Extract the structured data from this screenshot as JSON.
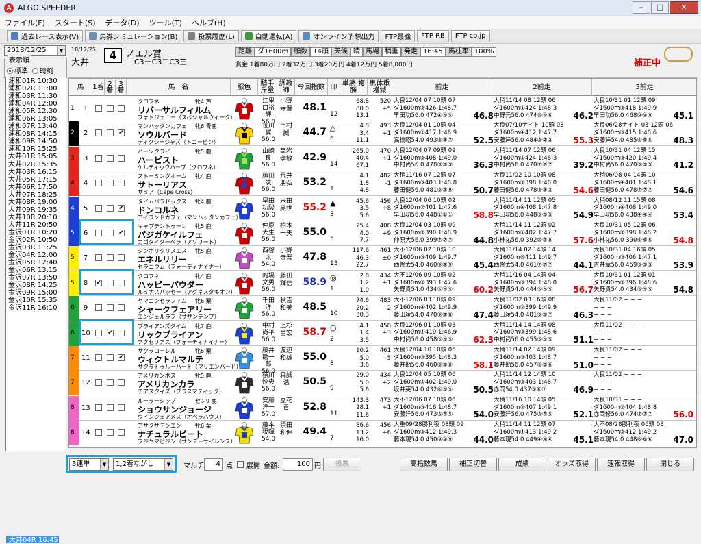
{
  "window": {
    "title": "ALGO SPEEDER",
    "controls": [
      "‒",
      "□",
      "✕"
    ]
  },
  "menu": [
    "ファイル(F)",
    "スタート(S)",
    "データ(D)",
    "ツール(T)",
    "ヘルプ(H)"
  ],
  "toolbar": [
    {
      "label": "過去レース表示(V)",
      "icon": "search-icon",
      "color": "#4a7fc1"
    },
    {
      "label": "馬券シミュレーション(B)",
      "icon": "ticket-icon",
      "color": "#6a8fb8"
    },
    {
      "label": "投票履歴(L)",
      "icon": "list-icon",
      "color": "#7f7f7f"
    },
    {
      "label": "自動運転(A)",
      "icon": "gear-icon",
      "color": "#3c9a3c"
    },
    {
      "label": "オンライン予想出力",
      "icon": "document-icon",
      "color": "#5b8cc0"
    },
    {
      "label": "FTP最強",
      "icon": "",
      "color": ""
    },
    {
      "label": "FTP RB",
      "icon": "",
      "color": ""
    },
    {
      "label": "FTP co.jp",
      "icon": "",
      "color": ""
    }
  ],
  "date": "2018/12/25",
  "order": {
    "legend": "表示順",
    "opt1": "標準",
    "opt2": "時刻"
  },
  "races": [
    {
      "label": "浦和01R 10:30"
    },
    {
      "label": "浦和02R 11:00"
    },
    {
      "label": "浦和03R 11:30"
    },
    {
      "label": "浦和04R 12:00"
    },
    {
      "label": "浦和05R 12:30"
    },
    {
      "label": "浦和06R 13:05"
    },
    {
      "label": "浦和07R 13:40"
    },
    {
      "label": "浦和08R 14:15"
    },
    {
      "label": "浦和09R 14:50"
    },
    {
      "label": "浦和10R 15:25"
    },
    {
      "label": "大井01R 15:05"
    },
    {
      "label": "大井02R 15:35"
    },
    {
      "label": "大井03R 16:15"
    },
    {
      "label": "大井04R 16:45",
      "selected": true
    },
    {
      "label": "大井05R 17:15"
    },
    {
      "label": "大井06R 17:50"
    },
    {
      "label": "大井07R 18:25"
    },
    {
      "label": "大井08R 19:00"
    },
    {
      "label": "大井09R 19:35"
    },
    {
      "label": "大井10R 20:10"
    },
    {
      "label": "大井11R 20:50"
    },
    {
      "label": "金沢01R 10:20"
    },
    {
      "label": "金沢02R 10:50"
    },
    {
      "label": "金沢03R 11:25"
    },
    {
      "label": "金沢04R 12:00"
    },
    {
      "label": "金沢05R 12:40"
    },
    {
      "label": "金沢06R 13:15"
    },
    {
      "label": "金沢07R 13:50"
    },
    {
      "label": "金沢08R 14:25"
    },
    {
      "label": "金沢09R 15:00"
    },
    {
      "label": "金沢10R 15:35"
    },
    {
      "label": "金沢11R 16:10"
    }
  ],
  "race": {
    "date": "18/12/25",
    "venue": "大井",
    "num": "4",
    "name": "ノエル賞",
    "cls": "C3ーC3二C3三",
    "info": [
      {
        "t": "距離",
        "s": "g"
      },
      {
        "t": "ダ1600m",
        "s": "w"
      },
      {
        "t": "頭数",
        "s": "g"
      },
      {
        "t": "14頭",
        "s": "w"
      },
      {
        "t": "天候",
        "s": "g"
      },
      {
        "t": "晴",
        "s": "w"
      },
      {
        "t": "馬場",
        "s": "g"
      },
      {
        "t": "稍重",
        "s": "w"
      },
      {
        "t": "発走",
        "s": "g"
      },
      {
        "t": "16:45",
        "s": "w"
      },
      {
        "t": "馬柱率",
        "s": "g"
      },
      {
        "t": "100%",
        "s": "w"
      }
    ],
    "prize": "賞金 1着80万円  2着32万円  3着20万円  4着12万円  5着8,000円",
    "correction": "補正中"
  },
  "columns": [
    "馬",
    "1着",
    "2着",
    "3着",
    "馬　名",
    "服色",
    "騎手\n斤量",
    "調教師",
    "今回指数",
    "印",
    "単勝\n複勝",
    "馬体重\n増減",
    "前走",
    "2前走",
    "3前走"
  ],
  "horses": [
    {
      "waku": "1",
      "wc": "#ffffff",
      "no": "1",
      "c1": "",
      "c2": "",
      "c3": "",
      "sire1": "クロフネ",
      "sx": "牝4 芦",
      "name": "リバーサルフィルム",
      "dam": "フォトジェニー（スペシャルウィーク）",
      "jock": "江里口裕輝 56.0",
      "trn": "小野寺晋",
      "idx": "48.1",
      "idxc": "#000",
      "mark": "",
      "pop": "12",
      "odds": "68.8\n80.0\n13.1",
      "wt": "520\n+5",
      "p": [
        {
          "a": "大良12/04  07 10頭 07",
          "b": "ダ1600m②426 1:48.7",
          "c": "早田功56.0 472④⑤⑤",
          "s": "46.8",
          "r": ""
        },
        {
          "a": "大稍11/14  08 12頭 06",
          "b": "ダ1600m①424 1:48:3",
          "c": "中野元56.0 474⑥⑥⑥",
          "s": "46.2",
          "r": ""
        },
        {
          "a": "大良10/31  01 12頭 09",
          "b": "ダ1600m③418 1:49.9",
          "c": "早田功56.0 468⑨⑨⑨",
          "s": "45.1",
          "r": ""
        }
      ]
    },
    {
      "waku": "2",
      "wc": "#000000",
      "no": "2",
      "c1": "",
      "c2": "",
      "c3": "✔",
      "sire1": "マンハッタンカフェ",
      "sx": "牝6 青鹿",
      "name": "ソウルバード",
      "dam": "ディクシージャズ（トニービン）",
      "jock": "笹川翼 56.0",
      "trn": "市村誠",
      "idx": "44.7",
      "idxc": "#000",
      "mark": "△",
      "pop": "6",
      "odds": "4.8\n3.4\n11.1",
      "wt": "493\n+1",
      "p": [
        {
          "a": "大良12/04  01 10頭 04",
          "b": "ダ1600m①417 1:46.9",
          "c": "高橋昭54.0 493⑧⑧⑦",
          "s": "52.5",
          "r": ""
        },
        {
          "a": "大良07/10ナイト 10頭 03",
          "b": "ダ1600m④412 1:47.7",
          "c": "安藤洋56.0 484②②②",
          "s": "55.3",
          "r": "red"
        },
        {
          "a": "大良06/28ナイト 03 12頭 06",
          "b": "ダ1600m⑤415 1:48.6",
          "c": "安藤洋54.0 485⑥⑥⑥",
          "s": "48.3",
          "r": ""
        }
      ]
    },
    {
      "waku": "3",
      "wc": "#e8231b",
      "no": "3",
      "c1": "",
      "c2": "",
      "c3": "",
      "sire1": "ハーツクライ",
      "sx": "牝5 鹿",
      "name": "ハーピスト",
      "dam": "ケルティックハープ（クロフネ）",
      "jock": "山崎良 56.0",
      "trn": "高岩孝敏",
      "idx": "42.9",
      "idxc": "#000",
      "mark": "",
      "pop": "14",
      "odds": "265.0\n40.4\n67.1",
      "wt": "470\n+1",
      "p": [
        {
          "a": "大良12/04  07 09頭 09",
          "b": "ダ1600m②408 1:49.0",
          "c": "中村尚56.0 478③③③",
          "s": "36.3",
          "r": ""
        },
        {
          "a": "大稍11/14  07 12頭 06",
          "b": "ダ1600m①424 1:48:3",
          "c": "中村尚56.0 470⑦⑦⑦",
          "s": "39.2",
          "r": ""
        },
        {
          "a": "大良10/31  04 12頭 15",
          "b": "ダ1600m③420 1:49.4",
          "c": "中村尚56.0 470⑤⑤⑤",
          "s": "41.2",
          "r": ""
        }
      ]
    },
    {
      "waku": "4",
      "wc": "#e8231b",
      "no": "4",
      "c1": "",
      "c2": "",
      "c3": "",
      "sire1": "ストーミングホーム",
      "sx": "牝4 鹿",
      "name": "サトーリアス",
      "dam": "ザミア（Cape Cross）",
      "jock": "藤田凌 56.0",
      "trn": "荒井朋弘",
      "idx": "53.2",
      "idxc": "#000",
      "mark": "",
      "pop": "1",
      "odds": "4.1\n1.8\n4.8",
      "wt": "482\n-1",
      "p": [
        {
          "a": "大稍11/16  07 12頭 07",
          "b": "ダ1600m③403 1:48.8",
          "c": "藤田健56.0 481⑨⑨⑨",
          "s": "50.7",
          "r": ""
        },
        {
          "a": "大良11/02  10 10頭 08",
          "b": "ダ1600m②398 1:48.0",
          "c": "藤田健56.0 478③③③",
          "s": "54.6",
          "r": "red"
        },
        {
          "a": "大稍06/08  04 14頭 10",
          "b": "ダ1600m④401 1:48.1",
          "c": "藤田健56.0 478⑦⑦⑦",
          "s": "54.6",
          "r": ""
        }
      ]
    },
    {
      "waku": "4",
      "wc": "#1c3fd8",
      "no": "5",
      "c1": "",
      "c2": "",
      "c3": "✔",
      "sire1": "タイムパラドックス",
      "sx": "牝4 鹿",
      "name": "ドンコルネ",
      "dam": "アイランドカフェ（マンハッタンカフェ）",
      "jock": "早田功駿 56.0",
      "trn": "米田英世",
      "idx": "55.2",
      "idxc": "#d00",
      "mark": "▲",
      "pop": "3",
      "odds": "45.6\n3.5\n5.6",
      "wt": "456\n+8",
      "p": [
        {
          "a": "大良12/04  06 10頭 02",
          "b": "ダ1600m②401 1:47.6",
          "c": "早田功56.0 448①①①",
          "s": "58.8",
          "r": "red"
        },
        {
          "a": "大稍11/14  11 12頭 05",
          "b": "ダ1600m④408 1:47.8",
          "c": "早田功56.0 448⑤⑤⑤",
          "s": "54.9",
          "r": ""
        },
        {
          "a": "大稍08/12  11 15頭 08",
          "b": "ダ1600m④408 1:49.0",
          "c": "早田功56.0 438④④④",
          "s": "53.4",
          "r": ""
        }
      ]
    },
    {
      "waku": "5",
      "wc": "#1c3fd8",
      "no": "6",
      "c1": "",
      "c2": "",
      "c3": "✔",
      "sire1": "キャプテントゥーレ",
      "sx": "牝5 鹿",
      "name": "パジガケイルフェ",
      "dam": "カゴタイターベラ（アゾリート）",
      "jock": "仲原大生 56.0",
      "trn": "柏木一夫",
      "idx": "55.0",
      "idxc": "#000",
      "mark": "",
      "pop": "5",
      "odds": "25.4\n4.0\n7.7",
      "wt": "408\n+9",
      "p": [
        {
          "a": "大良12/04  03 10頭 09",
          "b": "ダ1600m②390 1:48.9",
          "c": "仲原大56.0 399⑦⑦⑦",
          "s": "44.8",
          "r": ""
        },
        {
          "a": "大稍11/14  11 12頭 02",
          "b": "ダ1600m①402 1:47.7",
          "c": "小林祐56.0 392⑩⑨⑧",
          "s": "57.6",
          "r": "red"
        },
        {
          "a": "大良10/31  05 12頭 06",
          "b": "ダ1600m②398 1:48.2",
          "c": "小林祐56.0 390⑥⑥⑥",
          "s": "54.8",
          "r": "red"
        }
      ]
    },
    {
      "waku": "5",
      "wc": "#ffee00",
      "no": "7",
      "c1": "",
      "c2": "",
      "c3": "",
      "sire1": "シンボリクリスエス",
      "sx": "牝5 鹿",
      "name": "エネルリリー",
      "dam": "セラニウム（フォーティナイナー）",
      "jock": "西啓太 54.0",
      "trn": "小野寺晋",
      "idx": "47.8",
      "idxc": "#000",
      "mark": "",
      "pop": "13",
      "odds": "117.6\n46.3\n22.7",
      "wt": "461\n±0",
      "p": [
        {
          "a": "大不12/06  02 10頭 10",
          "b": "ダ1600m③409 1:49.7",
          "c": "西啓太54.0 460⑨⑨⑨",
          "s": "45.4",
          "r": ""
        },
        {
          "a": "大稍11/14  02 14頭 14",
          "b": "ダ1600m⑥411 1:49.7",
          "c": "西啓太54.0 461⑦⑦⑦",
          "s": "44.1",
          "r": ""
        },
        {
          "a": "大良10/31  04 16頭 05",
          "b": "ダ1600m③406 1:47.1",
          "c": "吉井章56.0 459⑤⑤⑤",
          "s": "53.9",
          "r": ""
        }
      ]
    },
    {
      "waku": "5",
      "wc": "#ffee00",
      "no": "8",
      "c1": "✔",
      "c2": "",
      "c3": "",
      "sire1": "クロフネ",
      "sx": "牝4 鹿",
      "name": "ハッピーパウダー",
      "dam": "ルミナスパッセー（アグネスタキオン）",
      "jock": "的場文男 56.0",
      "trn": "藤田輝信",
      "idx": "58.9",
      "idxc": "#1c2fb8",
      "mark": "◎",
      "pop": "1",
      "odds": "2.8\n1.2\n1.0",
      "wt": "434\n+1",
      "p": [
        {
          "a": "大不12/06  09 10頭 02",
          "b": "ダ1600m②393 1:47.6",
          "c": "矢野貴54.0 434⑤⑤⑤",
          "s": "60.2",
          "r": "red"
        },
        {
          "a": "大稍11/16  04 14頭 04",
          "b": "ダ1600m③394 1:48.0",
          "c": "矢野貴54.0 444⑤⑤⑤",
          "s": "56.7",
          "r": "red"
        },
        {
          "a": "大良10/31  01 12頭 01",
          "b": "ダ1600m②396 1:48.6",
          "c": "矢野貴54.0 434⑤⑤⑤",
          "s": "54.8",
          "r": ""
        }
      ]
    },
    {
      "waku": "6",
      "wc": "#1fa43a",
      "no": "9",
      "c1": "",
      "c2": "",
      "c3": "",
      "sire1": "ヤマニンセラフィム",
      "sx": "牝6 栗",
      "name": "シャークフェアリー",
      "dam": "エンジェルラフ（サザンテンプ）",
      "jock": "千田洋 56.0",
      "trn": "秋吉和美",
      "idx": "48.5",
      "idxc": "#000",
      "mark": "",
      "pop": "10",
      "odds": "74.6\n20.2\n30.3",
      "wt": "483\n-2",
      "p": [
        {
          "a": "大不12/06  03 10頭 09",
          "b": "ダ1600m④402 1:49.9",
          "c": "藤田凌54.0 470⑨⑨⑧",
          "s": "47.4",
          "r": ""
        },
        {
          "a": "大良11/02  03 16頭 08",
          "b": "ダ1600m②399 1:49.9",
          "c": "藤田凌54.0 481⑤⑥⑦",
          "s": "46.3",
          "r": ""
        },
        {
          "a": "大良11/02  − − −",
          "b": "− − −",
          "c": "− − −",
          "s": "",
          "r": ""
        }
      ]
    },
    {
      "waku": "6",
      "wc": "#1fa43a",
      "no": "10",
      "c1": "",
      "c2": "✔",
      "c3": "",
      "sire1": "ブライアンズタイム",
      "sx": "牝7 鹿",
      "name": "リックブライアン",
      "dam": "アクセリアス（フォーティナイナー）",
      "jock": "中村尚平 56.0",
      "trn": "上杉昌宏",
      "idx": "58.7",
      "idxc": "#d00",
      "mark": "○",
      "pop": "2",
      "odds": "4.1\n1.4\n3.5",
      "wt": "458\n+3",
      "p": [
        {
          "a": "大良12/06  01 10頭 03",
          "b": "ダ1600m④419 1:46.9",
          "c": "中村尚56.0 458⑤⑤⑤",
          "s": "62.3",
          "r": "red"
        },
        {
          "a": "大稍11/14  14 14頭 08",
          "b": "ダ1600m③399 1:48.6",
          "c": "中村尚56.0 455⑤⑤⑤",
          "s": "51.1",
          "r": ""
        },
        {
          "a": "大良11/02  − − −",
          "b": "− − −",
          "c": "− − −",
          "s": "",
          "r": ""
        }
      ]
    },
    {
      "waku": "7",
      "wc": "#ff8c00",
      "no": "11",
      "c1": "",
      "c2": "",
      "c3": "✔",
      "sire1": "サクラローレル",
      "sx": "牝6 栗",
      "name": "ウィクトルマルテ",
      "dam": "サクラトゥルーハート（マリエンバード）",
      "jock": "藤井勘一郎 56.0",
      "trn": "渡辺和雄",
      "idx": "55.0",
      "idxc": "#000",
      "mark": "",
      "pop": "8",
      "odds": "10.2\n5.0\n3.6",
      "wt": "461\n-5",
      "p": [
        {
          "a": "大良12/04  10 10頭 06",
          "b": "ダ1600m③395 1:48.3",
          "c": "藤井勘56.0 460⑧⑧⑧",
          "s": "58.1",
          "r": "red"
        },
        {
          "a": "大稍11/14  02 14頭 09",
          "b": "ダ1600m③403 1:48.7",
          "c": "藤井勘56.0 457⑥⑥⑥",
          "s": "51.0",
          "r": ""
        },
        {
          "a": "大良11/02  − − −",
          "b": "− − −",
          "c": "− − −",
          "s": "",
          "r": ""
        }
      ]
    },
    {
      "waku": "7",
      "wc": "#ff8c00",
      "no": "12",
      "c1": "",
      "c2": "",
      "c3": "",
      "sire1": "アメリカンボス",
      "sx": "牝5 鹿",
      "name": "アメリカンカラ",
      "dam": "チアスクイズ（ブラスマティック）",
      "jock": "横川怜央 56.0",
      "trn": "森誠浩",
      "idx": "50.5",
      "idxc": "#000",
      "mark": "",
      "pop": "9",
      "odds": "29.0\n5.0\n5.6",
      "wt": "434\n+2",
      "p": [
        {
          "a": "大良12/04  05 10頭 06",
          "b": "ダ1600m⑤402 1:49.0",
          "c": "坂井英54.0 432⑥⑤⑤",
          "s": "50.5",
          "r": ""
        },
        {
          "a": "大稍11/14  12 14頭 10",
          "b": "ダ1600m③403 1:48.7",
          "c": "赤岡54.0 437⑥⑥⑦",
          "s": "46.9",
          "r": ""
        },
        {
          "a": "大良11/02  − − −",
          "b": "− − −",
          "c": "− − −",
          "s": "",
          "r": ""
        }
      ]
    },
    {
      "waku": "8",
      "wc": "#f266c8",
      "no": "13",
      "c1": "",
      "c2": "",
      "c3": "",
      "sire1": "ルーラーシップ",
      "sx": "セン9 鹿",
      "name": "ショウサンジョージ",
      "dam": "ウインジェアメス（オペラハウス）",
      "jock": "安藤洋一 57.0",
      "trn": "立花貢",
      "idx": "52.8",
      "idxc": "#000",
      "mark": "",
      "pop": "11",
      "odds": "143.3\n28.1\n11.6",
      "wt": "473\n+1",
      "p": [
        {
          "a": "大不12/06  07 10頭 06",
          "b": "ダ1600m③416 1:48.7",
          "c": "安藤洋56.0 473⑤⑤⑤",
          "s": "54.0",
          "r": ""
        },
        {
          "a": "大稍11/16  10 14頭 05",
          "b": "ダ1600m②407 1:49.1",
          "c": "安藤洋56.0 475⑤⑤⑤",
          "s": "52.1",
          "r": ""
        },
        {
          "a": "大良10/31  − − −",
          "b": "ダ1600m②404 1:48.8",
          "c": "赤岡修56.0 474⑦⑦⑦",
          "s": "56.0",
          "r": "red"
        }
      ]
    },
    {
      "waku": "8",
      "wc": "#f266c8",
      "no": "14",
      "c1": "",
      "c2": "",
      "c3": "",
      "sire1": "アサクサデンエン",
      "sx": "牝6 栗",
      "name": "ナチュラルビート",
      "dam": "フジヤマビジン（サンデーサイレンス）",
      "jock": "藤本現暉 54.0",
      "trn": "須田和伸",
      "idx": "49.4",
      "idxc": "#000",
      "mark": "",
      "pop": "7",
      "odds": "86.6\n13.2\n16.0",
      "wt": "456\n+6",
      "p": [
        {
          "a": "大重09/28勝利夜 08頭 09",
          "b": "ダ1600m②412 1:49.3",
          "c": "藤本現54.0 450⑨⑨⑨",
          "s": "44.0",
          "r": ""
        },
        {
          "a": "大稍11/14  11 12頭 07",
          "b": "ダ1600m④413 1:49.2",
          "c": "藤本現54.0 449④④④",
          "s": "45.1",
          "r": ""
        },
        {
          "a": "大不08/28勝利夜 06頭 08",
          "b": "ダ1600m②412 1:49.2",
          "c": "藤本現54.0 448⑥⑥⑥",
          "s": "47.0",
          "r": ""
        }
      ]
    }
  ],
  "bottom": {
    "bet": "3連単",
    "mode": "1,2着ながし",
    "multi_label": "マルチ",
    "points": "4",
    "points_unit": "点",
    "expand": "展開",
    "amount_label": "金額:",
    "amount": "100",
    "yen": "円",
    "vote": "投票",
    "buttons": [
      "高指数馬",
      "補正切替",
      "成績",
      "オッズ取得",
      "速報取得",
      "閉じる"
    ]
  }
}
